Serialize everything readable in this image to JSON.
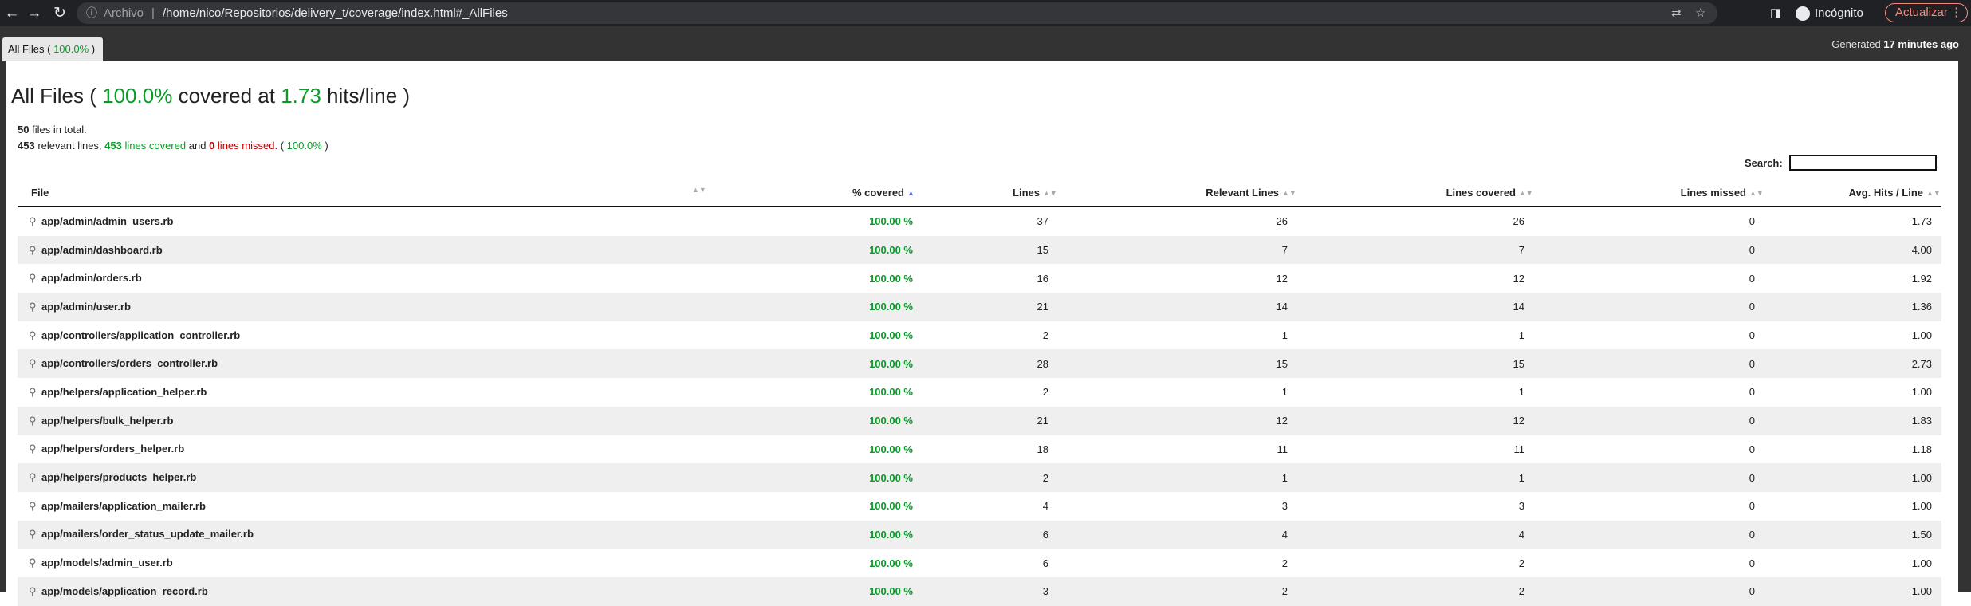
{
  "browser": {
    "back_glyph": "←",
    "forward_glyph": "→",
    "reload_glyph": "↻",
    "info_glyph": "ⓘ",
    "scheme_label": "Archivo",
    "separator": "|",
    "url": "/home/nico/Repositorios/delivery_t/coverage/index.html#_AllFiles",
    "translate_glyph": "⇄",
    "star_glyph": "☆",
    "sidepanel_glyph": "◨",
    "incognito_label": "Incógnito",
    "update_label": "Actualizar",
    "menu_glyph": "⋮"
  },
  "tab": {
    "label_prefix": "All Files (",
    "percent": "100.0%",
    "label_suffix": ")"
  },
  "generated": {
    "prefix": "Generated",
    "ago": "17 minutes ago"
  },
  "header": {
    "title_prefix": "All Files (",
    "covered_percent": "100.0%",
    "covered_mid": "covered at",
    "hits": "1.73",
    "hits_suffix": "hits/line )"
  },
  "summary": {
    "files_count": "50",
    "files_text": "files in total.",
    "relevant_count": "453",
    "relevant_text": "relevant lines,",
    "covered_count": "453",
    "covered_text": "lines covered",
    "and_text": "and",
    "missed_count": "0",
    "missed_text": "lines missed.",
    "pct_open": "(",
    "pct": "100.0%",
    "pct_close": ")"
  },
  "search": {
    "label": "Search:",
    "value": ""
  },
  "table": {
    "columns": {
      "file": "File",
      "covered": "% covered",
      "lines": "Lines",
      "relevant": "Relevant Lines",
      "lines_covered": "Lines covered",
      "lines_missed": "Lines missed",
      "avg_hits": "Avg. Hits / Line"
    },
    "sort_glyph": "▲▼",
    "active_sort_glyph": "▲",
    "magnifier_glyph": "⚲",
    "rows": [
      {
        "file": "app/admin/admin_users.rb",
        "covered": "100.00 %",
        "lines": "37",
        "relevant": "26",
        "lines_covered": "26",
        "missed": "0",
        "avg": "1.73"
      },
      {
        "file": "app/admin/dashboard.rb",
        "covered": "100.00 %",
        "lines": "15",
        "relevant": "7",
        "lines_covered": "7",
        "missed": "0",
        "avg": "4.00"
      },
      {
        "file": "app/admin/orders.rb",
        "covered": "100.00 %",
        "lines": "16",
        "relevant": "12",
        "lines_covered": "12",
        "missed": "0",
        "avg": "1.92"
      },
      {
        "file": "app/admin/user.rb",
        "covered": "100.00 %",
        "lines": "21",
        "relevant": "14",
        "lines_covered": "14",
        "missed": "0",
        "avg": "1.36"
      },
      {
        "file": "app/controllers/application_controller.rb",
        "covered": "100.00 %",
        "lines": "2",
        "relevant": "1",
        "lines_covered": "1",
        "missed": "0",
        "avg": "1.00"
      },
      {
        "file": "app/controllers/orders_controller.rb",
        "covered": "100.00 %",
        "lines": "28",
        "relevant": "15",
        "lines_covered": "15",
        "missed": "0",
        "avg": "2.73"
      },
      {
        "file": "app/helpers/application_helper.rb",
        "covered": "100.00 %",
        "lines": "2",
        "relevant": "1",
        "lines_covered": "1",
        "missed": "0",
        "avg": "1.00"
      },
      {
        "file": "app/helpers/bulk_helper.rb",
        "covered": "100.00 %",
        "lines": "21",
        "relevant": "12",
        "lines_covered": "12",
        "missed": "0",
        "avg": "1.83"
      },
      {
        "file": "app/helpers/orders_helper.rb",
        "covered": "100.00 %",
        "lines": "18",
        "relevant": "11",
        "lines_covered": "11",
        "missed": "0",
        "avg": "1.18"
      },
      {
        "file": "app/helpers/products_helper.rb",
        "covered": "100.00 %",
        "lines": "2",
        "relevant": "1",
        "lines_covered": "1",
        "missed": "0",
        "avg": "1.00"
      },
      {
        "file": "app/mailers/application_mailer.rb",
        "covered": "100.00 %",
        "lines": "4",
        "relevant": "3",
        "lines_covered": "3",
        "missed": "0",
        "avg": "1.00"
      },
      {
        "file": "app/mailers/order_status_update_mailer.rb",
        "covered": "100.00 %",
        "lines": "6",
        "relevant": "4",
        "lines_covered": "4",
        "missed": "0",
        "avg": "1.50"
      },
      {
        "file": "app/models/admin_user.rb",
        "covered": "100.00 %",
        "lines": "6",
        "relevant": "2",
        "lines_covered": "2",
        "missed": "0",
        "avg": "1.00"
      },
      {
        "file": "app/models/application_record.rb",
        "covered": "100.00 %",
        "lines": "3",
        "relevant": "2",
        "lines_covered": "2",
        "missed": "0",
        "avg": "1.00"
      }
    ]
  }
}
